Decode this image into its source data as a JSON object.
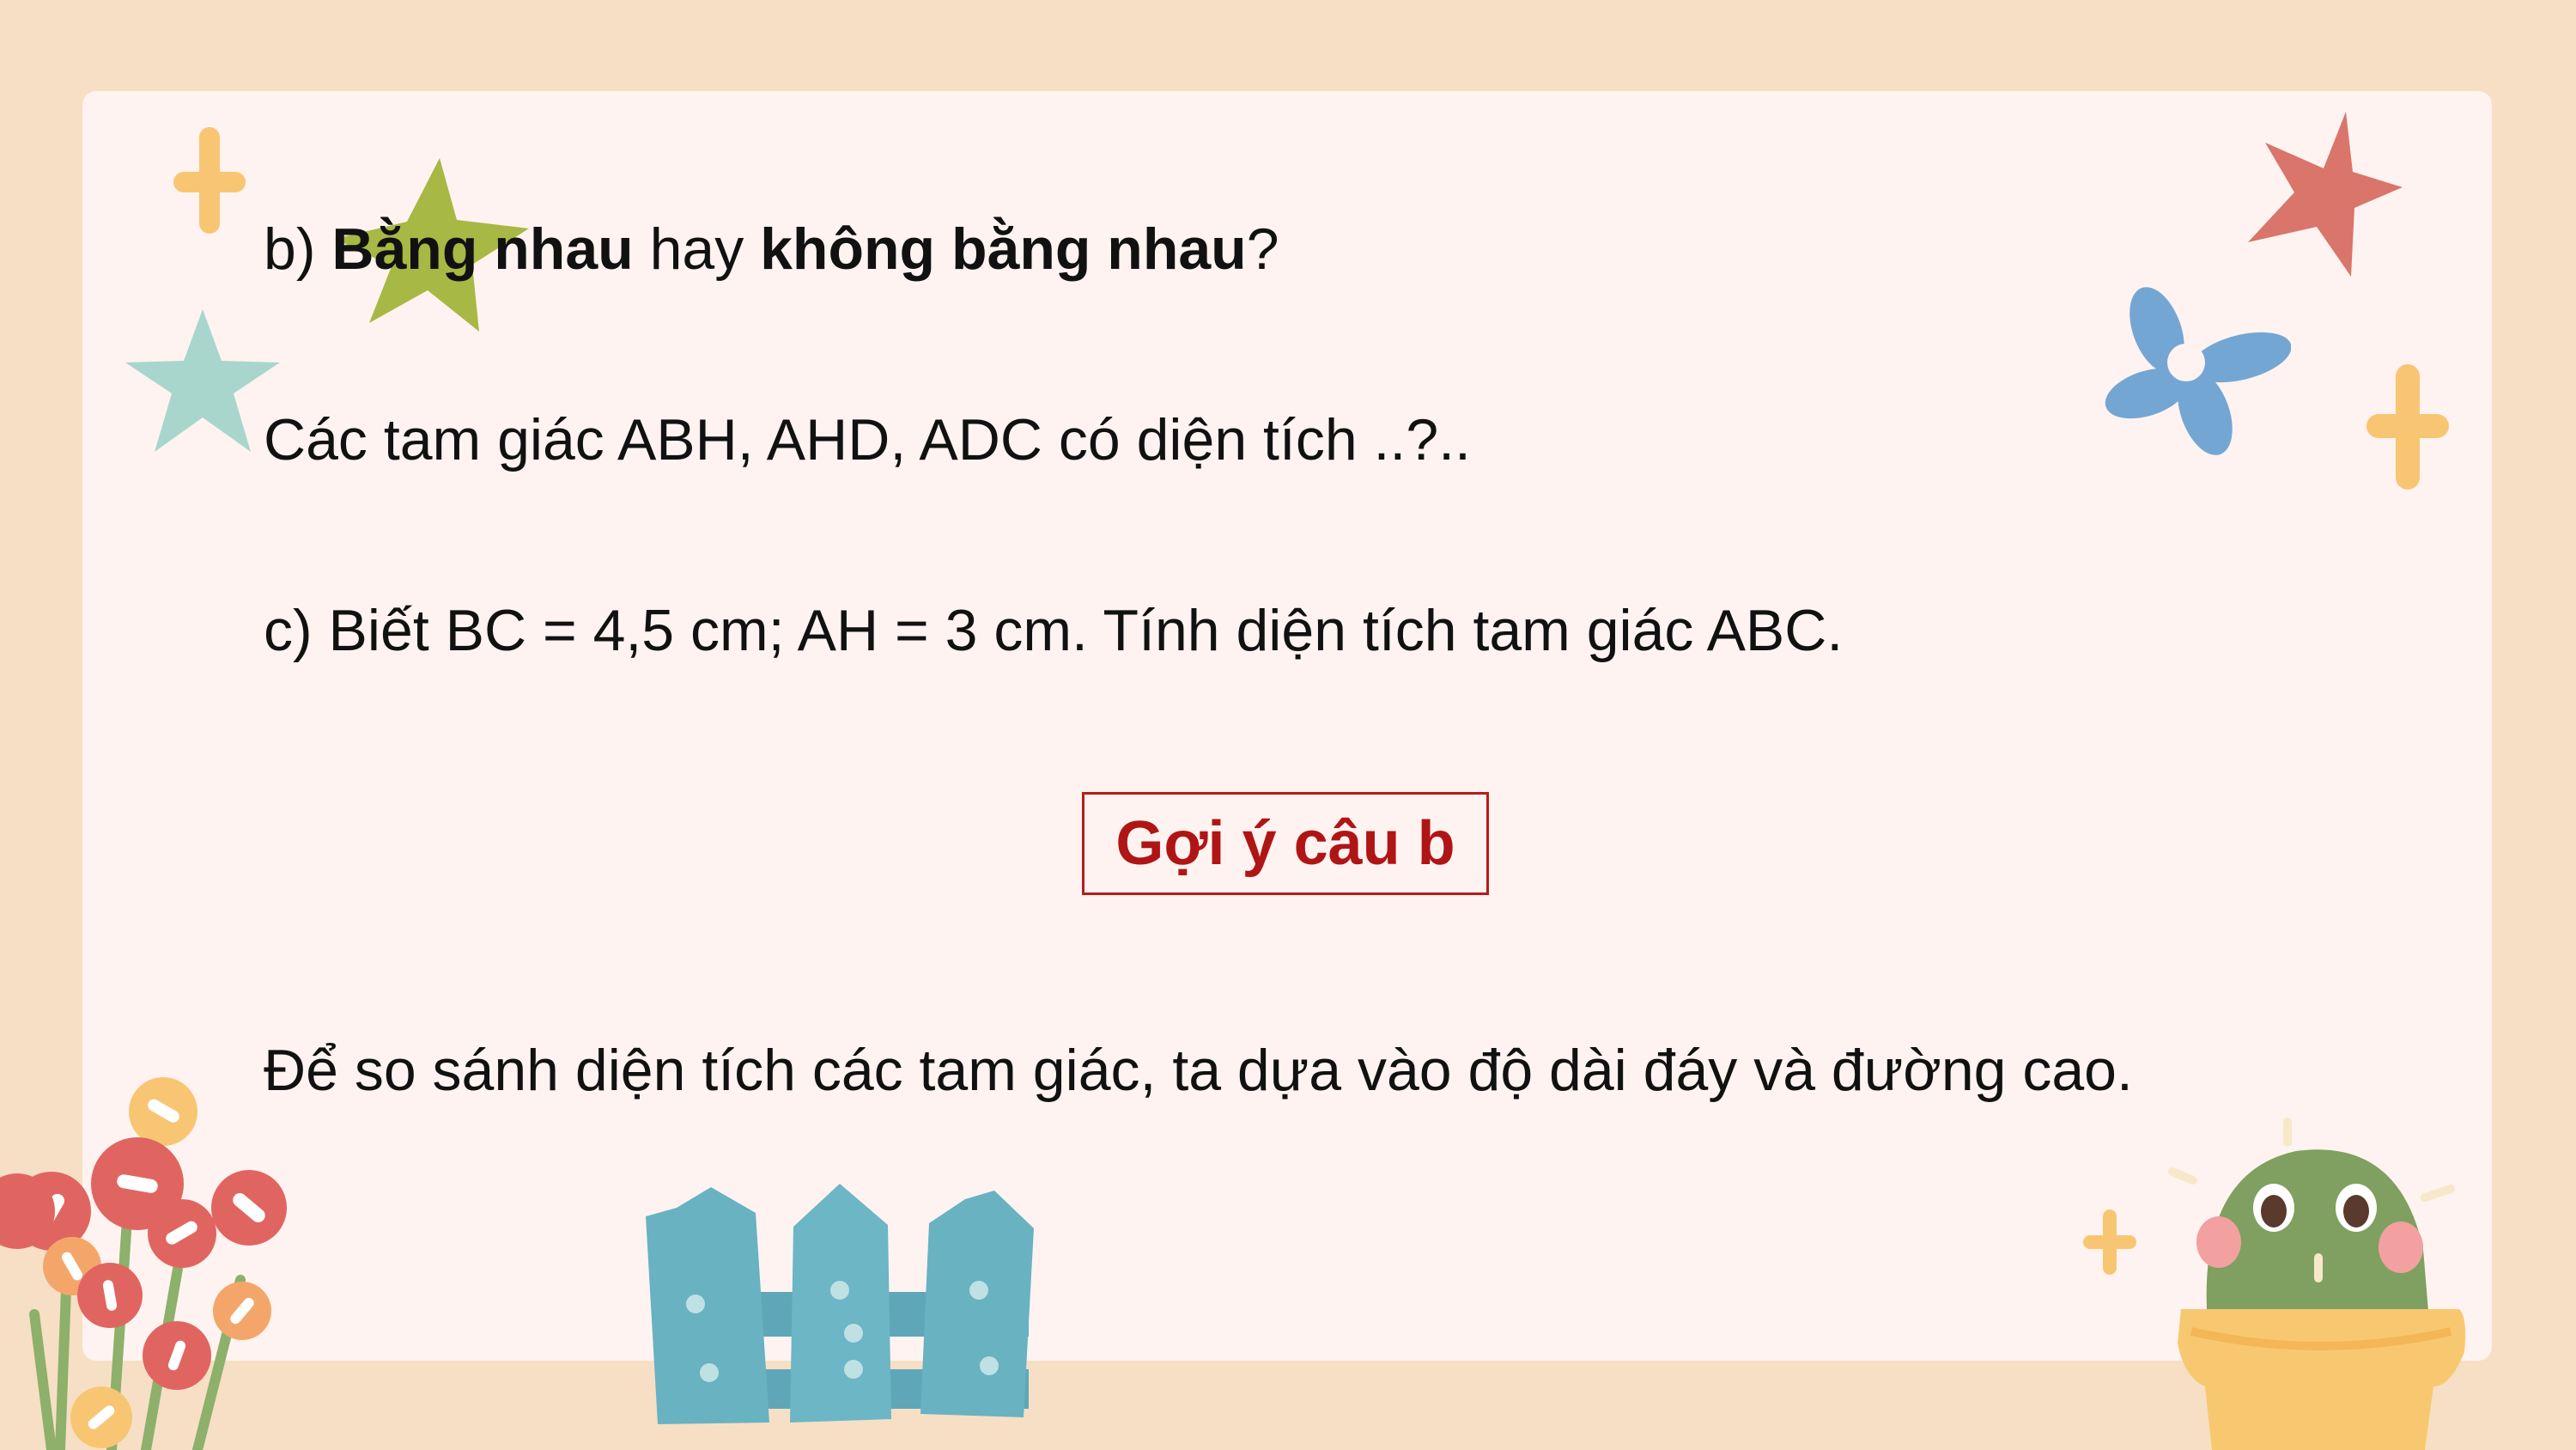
{
  "slide": {
    "question_b": {
      "prefix": "b) ",
      "bold1": "Bằng nhau",
      "middle": " hay ",
      "bold2": "không bằng nhau",
      "suffix": "?"
    },
    "statement": "Các tam giác ABH, AHD, ADC có diện tích ..?..",
    "question_c": "c) Biết BC = 4,5 cm; AH = 3 cm. Tính diện tích tam giác ABC.",
    "hint_button": "Gợi ý câu b",
    "explanation": "Để so sánh diện tích các tam giác, ta dựa vào độ dài đáy và đường cao."
  },
  "colors": {
    "page_background": "#f7dfc5",
    "card_background": "#fef3f0",
    "hint_text": "#b01515",
    "hint_border": "#b71c1c",
    "star_green": "#a8b844",
    "star_teal": "#a8d6cc",
    "star_red": "#d9756a",
    "flower_blue": "#74a6d3",
    "plus_yellow": "#f8c673",
    "fence_teal": "#68b2c2",
    "cactus_green": "#7fa060",
    "pot_yellow": "#f8c870"
  },
  "decorations": [
    "green-star-icon",
    "teal-star-icon",
    "red-star-icon",
    "blue-flower-icon",
    "plus-icon",
    "fence-icon",
    "cactus-icon",
    "flowers-icon"
  ]
}
